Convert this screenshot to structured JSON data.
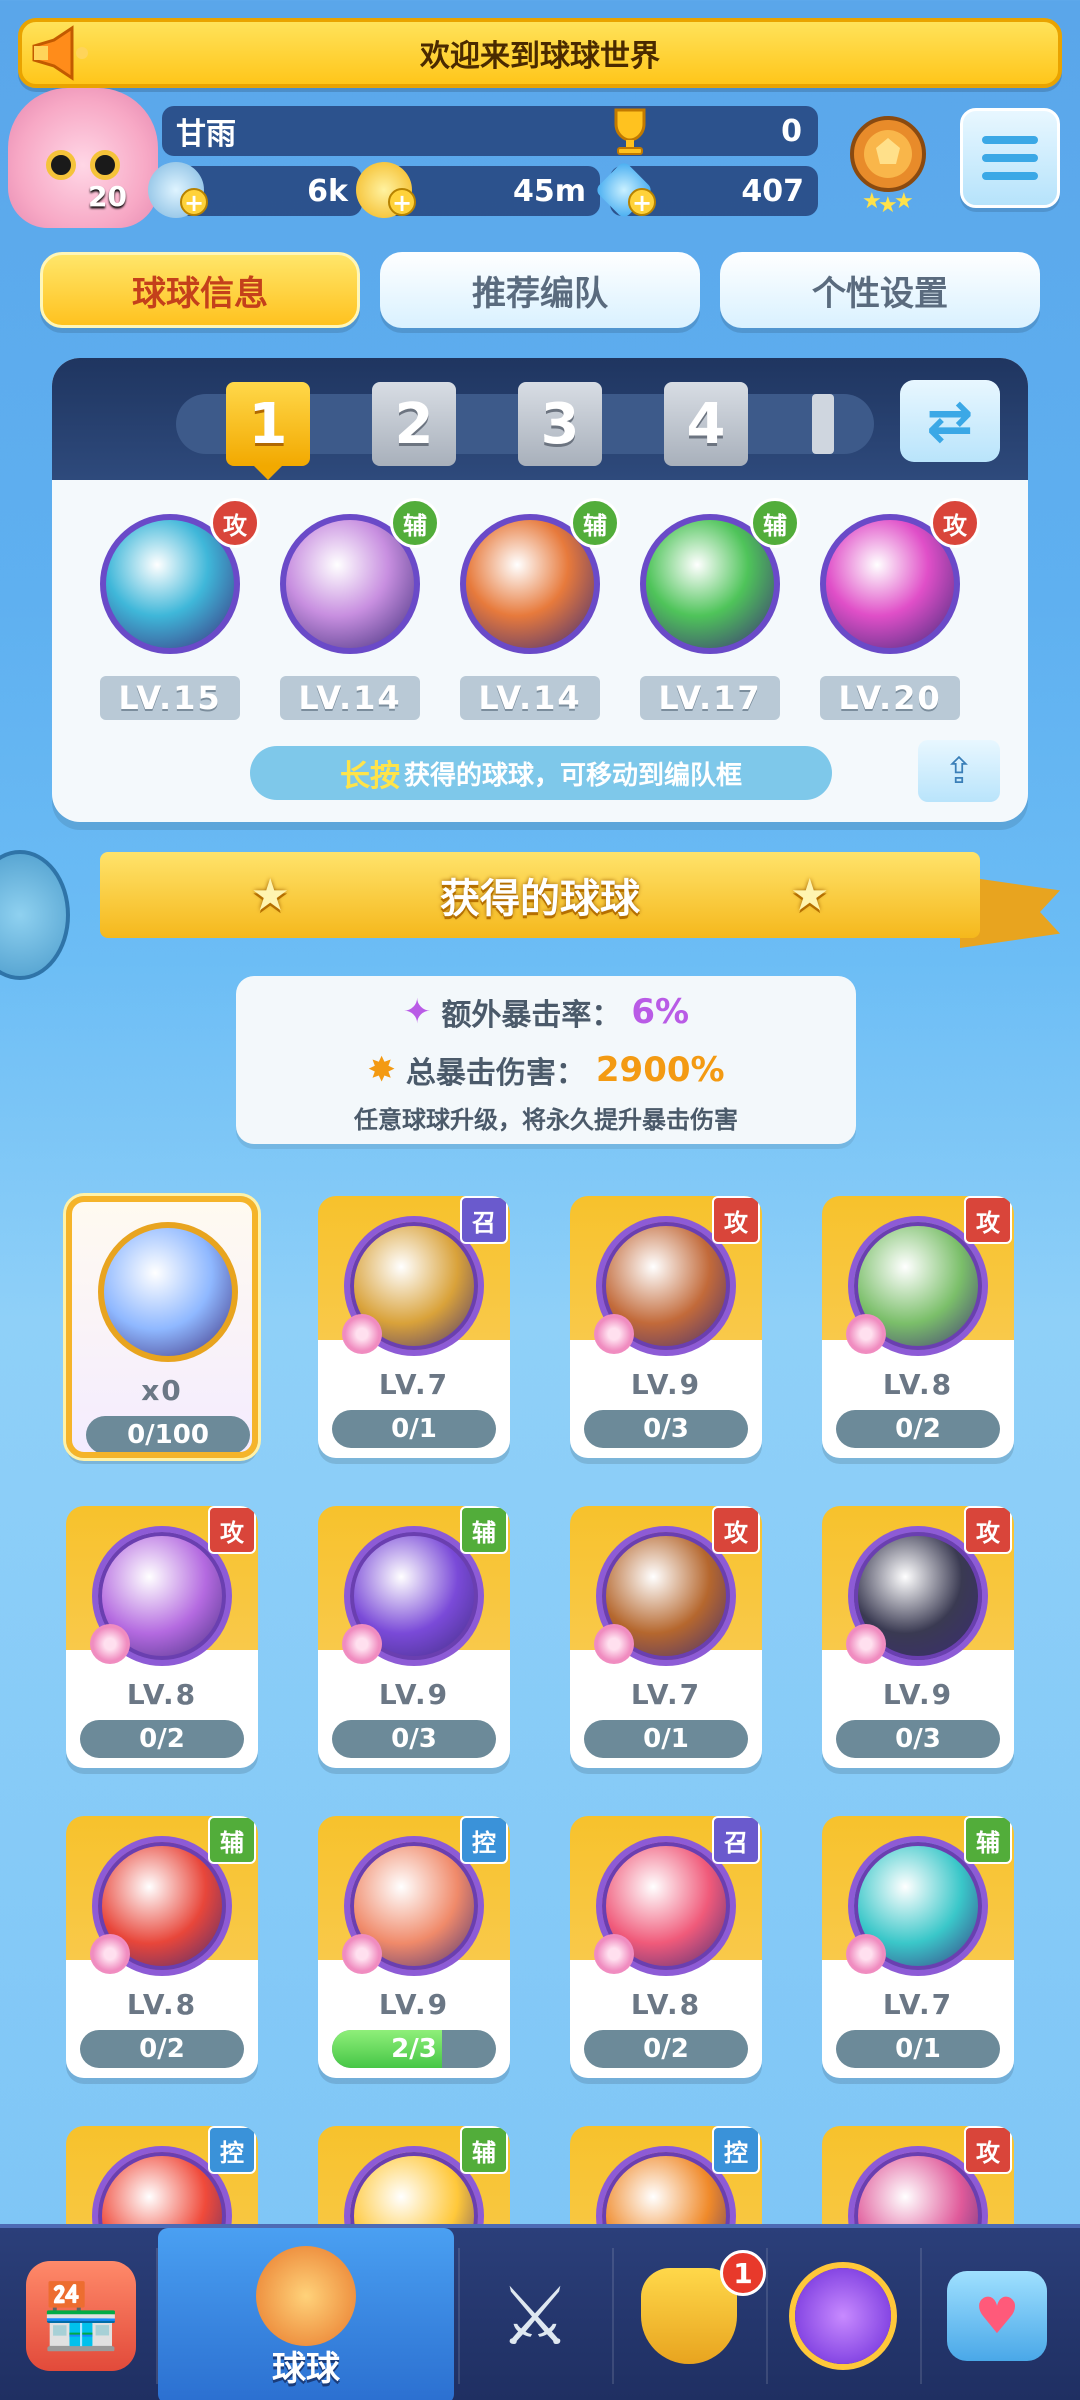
{
  "banner": {
    "text": "欢迎来到球球世界"
  },
  "player": {
    "name": "甘雨",
    "level": "20",
    "trophies": "0",
    "resources": [
      {
        "icon": "energy-icon",
        "value": "6k"
      },
      {
        "icon": "coin-icon",
        "value": "45m"
      },
      {
        "icon": "diamond-icon",
        "value": "407"
      }
    ]
  },
  "tabs": [
    {
      "label": "球球信息",
      "active": true
    },
    {
      "label": "推荐编队",
      "active": false
    },
    {
      "label": "个性设置",
      "active": false
    }
  ],
  "formation": {
    "slots": [
      "1",
      "2",
      "3",
      "4"
    ],
    "active_slot": "1",
    "balls": [
      {
        "role": "攻",
        "level": "LV.15",
        "color": "#3fb7d9"
      },
      {
        "role": "辅",
        "level": "LV.14",
        "color": "#c88fe0"
      },
      {
        "role": "辅",
        "level": "LV.14",
        "color": "#e77a3c"
      },
      {
        "role": "辅",
        "level": "LV.17",
        "color": "#4fc45a"
      },
      {
        "role": "攻",
        "level": "LV.20",
        "color": "#e04fc8"
      }
    ],
    "hint_highlight": "长按",
    "hint_text": "获得的球球，可移动到编队框"
  },
  "owned_section": {
    "title": "获得的球球",
    "crit_rate_label": "额外暴击率：",
    "crit_rate_value": "6%",
    "crit_damage_label": "总暴击伤害：",
    "crit_damage_value": "2900%",
    "note": "任意球球升级，将永久提升暴击伤害"
  },
  "owned_balls": [
    {
      "special": true,
      "count": "x0",
      "progress": "0/100",
      "fill": 0,
      "color": "#8fb8ff"
    },
    {
      "role": "召",
      "level": "LV.7",
      "progress": "0/1",
      "fill": 0,
      "color": "#d9a23a"
    },
    {
      "role": "攻",
      "level": "LV.9",
      "progress": "0/3",
      "fill": 0,
      "color": "#c26a3a"
    },
    {
      "role": "攻",
      "level": "LV.8",
      "progress": "0/2",
      "fill": 0,
      "color": "#7bbf6a"
    },
    {
      "role": "攻",
      "level": "LV.8",
      "progress": "0/2",
      "fill": 0,
      "color": "#b46ae0"
    },
    {
      "role": "辅",
      "level": "LV.9",
      "progress": "0/3",
      "fill": 0,
      "color": "#7a4ad8"
    },
    {
      "role": "攻",
      "level": "LV.7",
      "progress": "0/1",
      "fill": 0,
      "color": "#b5672e"
    },
    {
      "role": "攻",
      "level": "LV.9",
      "progress": "0/3",
      "fill": 0,
      "color": "#3a3a52"
    },
    {
      "role": "辅",
      "level": "LV.8",
      "progress": "0/2",
      "fill": 0,
      "color": "#e8463a"
    },
    {
      "role": "控",
      "level": "LV.9",
      "progress": "2/3",
      "fill": 0.67,
      "color": "#f08a6a"
    },
    {
      "role": "召",
      "level": "LV.8",
      "progress": "0/2",
      "fill": 0,
      "color": "#f05a7a"
    },
    {
      "role": "辅",
      "level": "LV.7",
      "progress": "0/1",
      "fill": 0,
      "color": "#3ac7c9"
    },
    {
      "role": "控",
      "level": "",
      "progress": "",
      "fill": 0,
      "color": "#f04a3a"
    },
    {
      "role": "辅",
      "level": "",
      "progress": "",
      "fill": 0,
      "color": "#ffc83a"
    },
    {
      "role": "控",
      "level": "",
      "progress": "",
      "fill": 0,
      "color": "#f08a2a"
    },
    {
      "role": "攻",
      "level": "",
      "progress": "",
      "fill": 0,
      "color": "#e05a9a"
    }
  ],
  "role_colors": {
    "攻": "#d9453a",
    "辅": "#52ad3a",
    "控": "#3a92d9",
    "召": "#6a5acd"
  },
  "bottom_nav": [
    {
      "name": "shop",
      "icon": "shop-icon",
      "label": ""
    },
    {
      "name": "balls",
      "icon": "ball-jar-icon",
      "label": "球球",
      "active": true
    },
    {
      "name": "battle",
      "icon": "crossed-swords-icon",
      "label": ""
    },
    {
      "name": "tasks",
      "icon": "whistle-icon",
      "label": "",
      "badge": "1"
    },
    {
      "name": "planet",
      "icon": "planet-icon",
      "label": ""
    },
    {
      "name": "social",
      "icon": "chat-heart-icon",
      "label": ""
    }
  ]
}
